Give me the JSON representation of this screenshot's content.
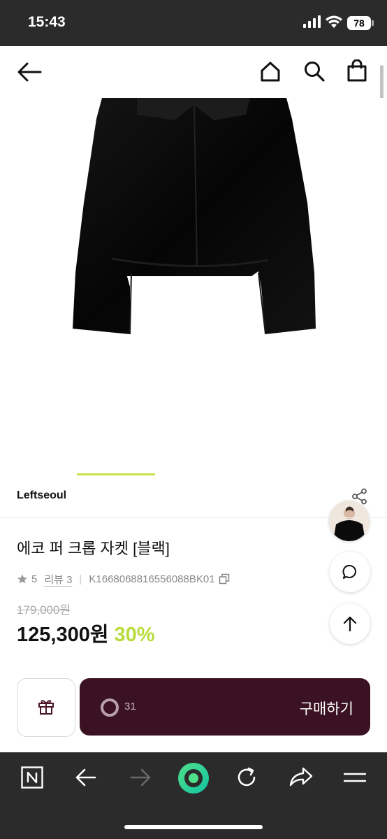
{
  "status_bar": {
    "time": "15:43",
    "battery": "78"
  },
  "product": {
    "brand": "Leftseoul",
    "title": "에코 퍼 크롭 자켓 [블랙]",
    "rating": "5",
    "review_label": "리뷰 3",
    "product_code": "K1668068816556088BK01",
    "original_price": "179,000원",
    "sale_price": "125,300원",
    "discount": "30%"
  },
  "purchase_bar": {
    "like_count": "31",
    "buy_label": "구매하기"
  },
  "colors": {
    "accent_green": "#b8dc3b",
    "buy_button": "#3a1221",
    "system_bar": "#2b2b2b"
  },
  "icons": [
    "back-arrow-icon",
    "home-icon",
    "search-icon",
    "bag-icon",
    "share-icon",
    "chat-icon",
    "arrow-up-icon",
    "gift-icon",
    "naver-icon",
    "browser-back-icon",
    "browser-forward-icon",
    "green-dot-icon",
    "refresh-icon",
    "share-forward-icon",
    "menu-icon"
  ]
}
